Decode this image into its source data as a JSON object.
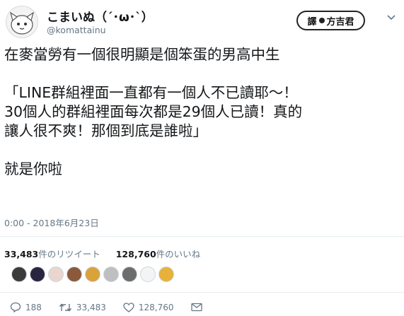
{
  "user": {
    "display_name": "こまいぬ（´･ω･`）",
    "handle": "@komattainu"
  },
  "watermark": {
    "text": "方吉君",
    "prefix": "譯"
  },
  "tweet": {
    "text": "在麥當勞有一個很明顯是個笨蛋的男高中生\n\n「LINE群組裡面一直都有一個人不已讀耶〜！\n30個人的群組裡面每次都是29個人已讀！真的\n讓人很不爽！那個到底是誰啦」\n\n就是你啦",
    "timestamp": "0:00 - 2018年6月23日"
  },
  "stats": {
    "retweets_count": "33,483",
    "retweets_label": "件のリツイート",
    "likes_count": "128,760",
    "likes_label": "件のいいね"
  },
  "likers": [
    "#3b3b3b",
    "#2a2440",
    "#e9d6cf",
    "#8a5a3a",
    "#d9a23a",
    "#bfbfbf",
    "#6d6d6d",
    "#f4f4f4",
    "#e8b23a"
  ],
  "actions": {
    "reply_count": "188",
    "retweet_count": "33,483",
    "like_count": "128,760"
  }
}
